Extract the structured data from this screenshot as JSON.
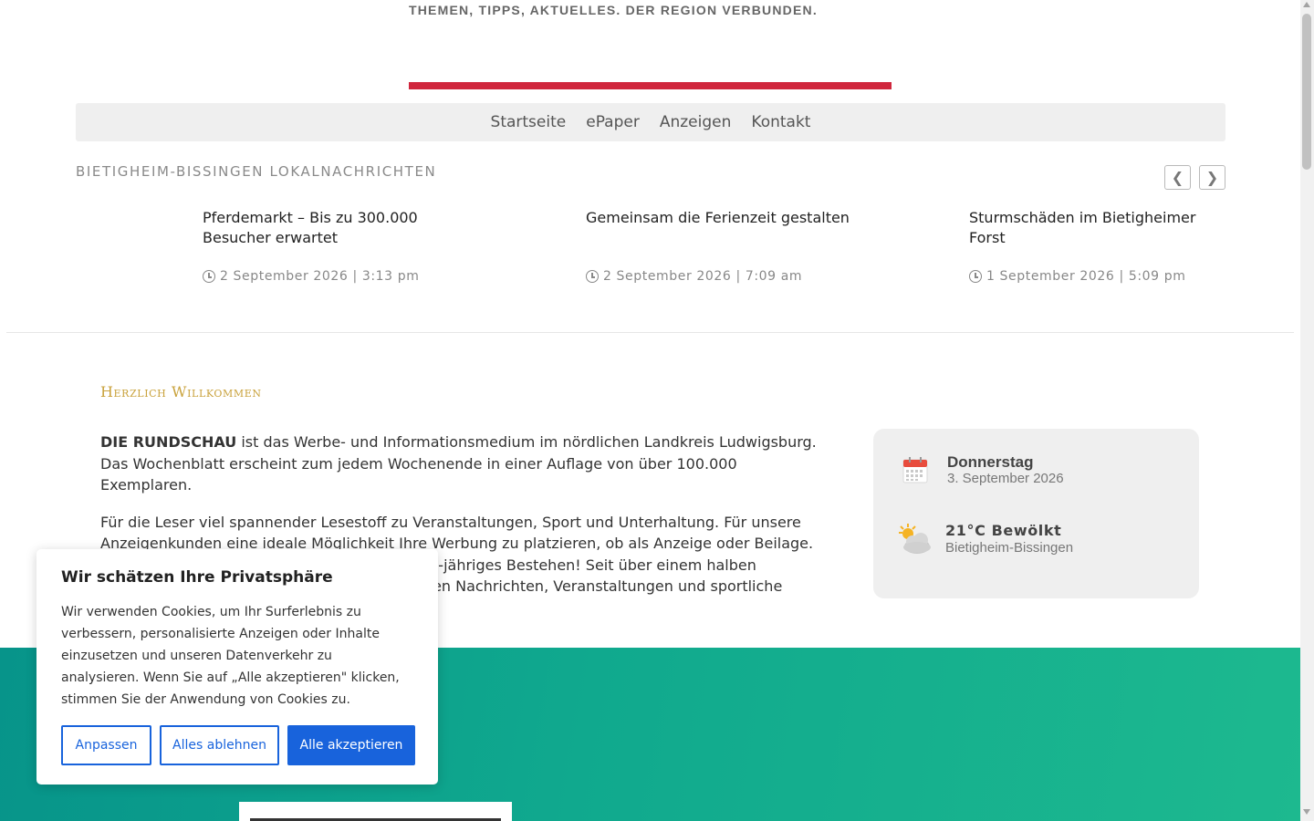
{
  "header": {
    "tagline": "THEMEN, TIPPS, AKTUELLES. DER REGION VERBUNDEN.",
    "accent_color": "#d0263d"
  },
  "nav": {
    "items": [
      {
        "label": "Startseite"
      },
      {
        "label": "ePaper"
      },
      {
        "label": "Anzeigen"
      },
      {
        "label": "Kontakt"
      }
    ]
  },
  "news": {
    "heading": "BIETIGHEIM-BISSINGEN LOKALNACHRICHTEN",
    "prev_label": "❮",
    "next_label": "❯",
    "items": [
      {
        "title": "Pferdemarkt – Bis zu 300.000 Besucher erwartet",
        "date": "2 September 2026 | 3:13 pm"
      },
      {
        "title": "Gemeinsam die Ferienzeit gestalten",
        "date": "2 September 2026 | 7:09 am"
      },
      {
        "title": "Sturmschäden im Bietigheimer Forst",
        "date": "1 September 2026 | 5:09 pm"
      }
    ]
  },
  "welcome": {
    "heading": "Herzlich Willkommen",
    "brand": "DIE RUNDSCHAU",
    "para1_rest": " ist das Werbe- und Informationsmedium im nördlichen Landkreis Ludwigsburg. Das Wochenblatt erscheint zum jedem Wochenende in einer Auflage von über 100.000 Exemplaren.",
    "para2": "Für die Leser viel spannender Lesestoff zu Veranstaltungen, Sport und Unterhaltung. Für unsere Anzeigenkunden eine ideale Möglichkeit Ihre Werbung zu platzieren, ob als Anzeige oder Beilage. DIE RUNDSCHAU feierte in 2024 bereits ihr 50-jähriges Bestehen! Seit über einem halben Jahrhundert informiert sie ihre Leser mit lokalen Nachrichten, Veranstaltungen und sportliche"
  },
  "info": {
    "day": "Donnerstag",
    "date": "3. September 2026",
    "temp": "21°C  Bewölkt",
    "place": "Bietigheim-Bissingen",
    "calendar_icon": "calendar-icon",
    "weather_icon": "partly-cloudy-icon"
  },
  "cookie": {
    "title": "Wir schätzen Ihre Privatsphäre",
    "text": "Wir verwenden Cookies, um Ihr Surferlebnis zu verbessern, personalisierte Anzeigen oder Inhalte einzusetzen und unseren Datenverkehr zu analysieren. Wenn Sie auf „Alle akzeptieren\" klicken, stimmen Sie der Anwendung von Cookies zu.",
    "customize_label": "Anpassen",
    "reject_label": "Alles ablehnen",
    "accept_label": "Alle akzeptieren",
    "button_color": "#1863dc"
  },
  "colors": {
    "welcome_heading": "#c9a23c",
    "teal_start": "#07948a",
    "teal_end": "#1db98f"
  }
}
